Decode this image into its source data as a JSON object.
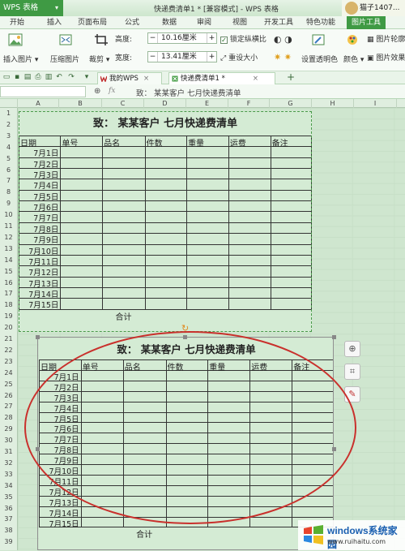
{
  "titlebar": {
    "app_menu": "WPS 表格",
    "document_title": "快递费清单1 * [兼容模式] - WPS 表格",
    "account": "猫子1407..."
  },
  "menu": [
    "开始",
    "插入",
    "页面布局",
    "公式",
    "数据",
    "审阅",
    "视图",
    "开发工具",
    "特色功能",
    "图片工具"
  ],
  "ribbon": {
    "insert_picture": "插入图片",
    "compress_picture": "压缩图片",
    "crop": "裁剪",
    "height_label": "高度:",
    "height_value": "10.16厘米",
    "width_label": "宽度:",
    "width_value": "13.41厘米",
    "lock_ratio": "锁定纵横比",
    "reset_size": "重设大小",
    "set_transparent": "设置透明色",
    "color": "颜色",
    "picture_outline": "图片轮廓",
    "picture_effects": "图片效果"
  },
  "tabs": [
    {
      "label": "我的WPS"
    },
    {
      "label": "快递费清单1 *"
    }
  ],
  "formula": {
    "fx": "fx",
    "content": "致：  某某客户   七月快递费清单"
  },
  "columns": [
    "A",
    "B",
    "C",
    "D",
    "E",
    "F",
    "G",
    "H",
    "I"
  ],
  "rows": [
    "1",
    "2",
    "3",
    "4",
    "5",
    "6",
    "7",
    "8",
    "9",
    "10",
    "11",
    "12",
    "13",
    "14",
    "15",
    "16",
    "17",
    "18",
    "19",
    "20",
    "21",
    "22",
    "23",
    "24",
    "25",
    "26",
    "27",
    "28",
    "29",
    "30",
    "31",
    "32",
    "33",
    "34",
    "35",
    "36",
    "37",
    "38",
    "39"
  ],
  "sheet": {
    "title": "致：  某某客户   七月快递费清单",
    "headers": [
      "日期",
      "单号",
      "品名",
      "件数",
      "重量",
      "运费",
      "备注"
    ],
    "dates": [
      "7月1日",
      "7月2日",
      "7月3日",
      "7月4日",
      "7月5日",
      "7月6日",
      "7月7日",
      "7月8日",
      "7月9日",
      "7月10日",
      "7月11日",
      "7月12日",
      "7月13日",
      "7月14日",
      "7月15日"
    ],
    "total": "合计"
  },
  "watermark": {
    "title": "windows系统家园",
    "url": "www.ruihaitu.com"
  },
  "colors": {
    "accent": "#3f9a44",
    "annotation": "#c9302c"
  }
}
